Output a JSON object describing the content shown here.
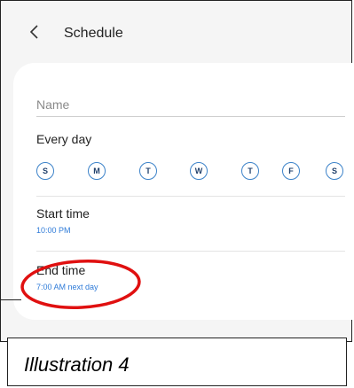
{
  "header": {
    "title": "Schedule",
    "back_icon": "chevron-left-icon"
  },
  "form": {
    "name_placeholder": "Name",
    "name_value": "",
    "repeat_label": "Every day",
    "days": [
      "S",
      "M",
      "T",
      "W",
      "T",
      "F",
      "S"
    ],
    "start_time": {
      "label": "Start time",
      "value": "10:00 PM"
    },
    "end_time": {
      "label": "End time",
      "value": "7:00 AM next day"
    }
  },
  "caption": "Illustration 4",
  "colors": {
    "accent": "#2f7bd8",
    "highlight_circle": "#e01010",
    "background": "#f5f5f5",
    "card": "#ffffff"
  }
}
